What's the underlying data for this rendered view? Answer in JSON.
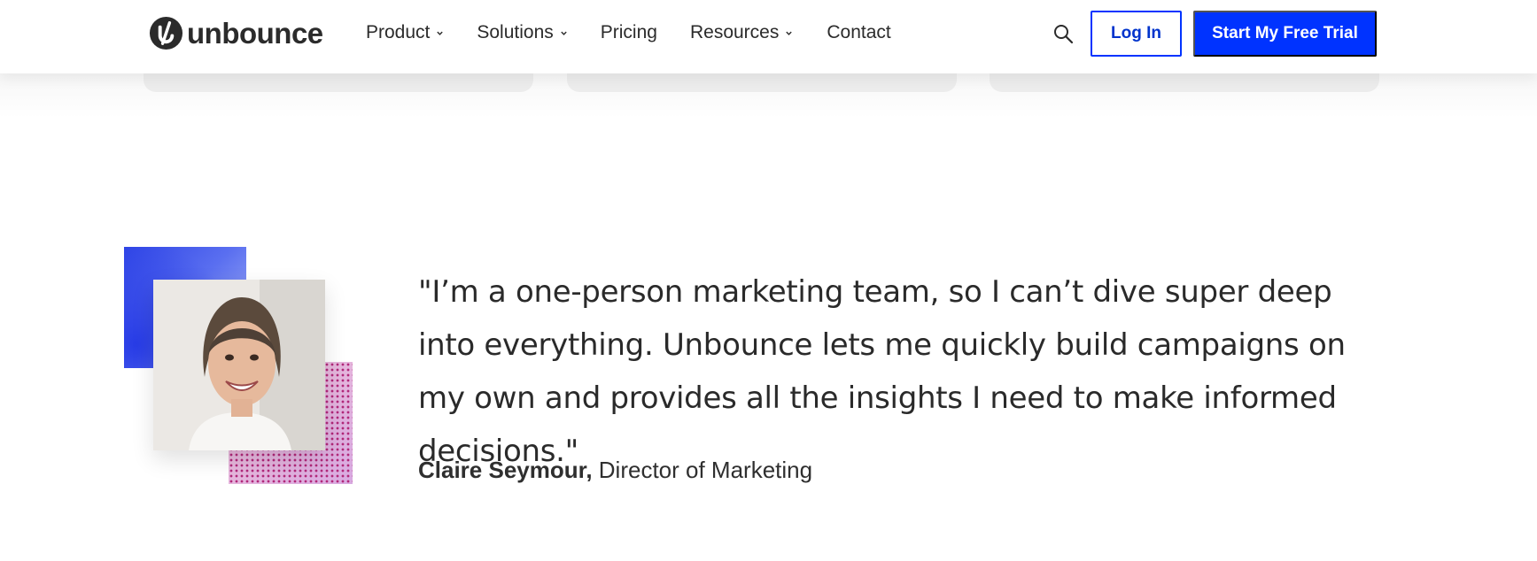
{
  "header": {
    "brand": "unbounce",
    "nav": [
      {
        "label": "Product",
        "has_dropdown": true
      },
      {
        "label": "Solutions",
        "has_dropdown": true
      },
      {
        "label": "Pricing",
        "has_dropdown": false
      },
      {
        "label": "Resources",
        "has_dropdown": true
      },
      {
        "label": "Contact",
        "has_dropdown": false
      }
    ],
    "search_icon": "search-icon",
    "login_label": "Log In",
    "trial_label": "Start My Free Trial"
  },
  "testimonial": {
    "quote": "\"I’m a one-person marketing team, so I can’t dive super deep into everything. Unbounce lets me quickly build campaigns on my own and provides all the insights I need to make informed decisions.\"",
    "name": "Claire Seymour,",
    "title": "Director of Marketing"
  },
  "colors": {
    "brand_blue": "#0033ff",
    "text_dark": "#2a2a2a",
    "card_gray": "#ececec"
  }
}
